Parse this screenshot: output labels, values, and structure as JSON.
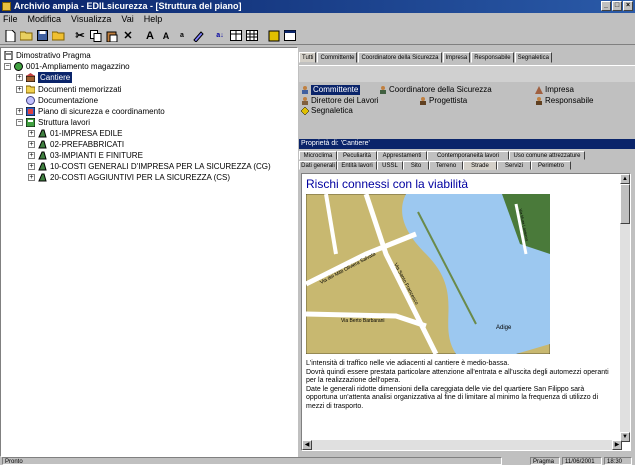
{
  "window": {
    "title": "Archivio ampia - EDILsicurezza - [Struttura del piano]"
  },
  "menu": [
    "File",
    "Modifica",
    "Visualizza",
    "Vai",
    "Help"
  ],
  "toolbar": {
    "icons": [
      "new-icon",
      "open-icon",
      "save-icon",
      "folder-icon",
      "cut-icon",
      "copy-icon",
      "paste-icon",
      "delete-icon",
      "font-bold-icon",
      "font-size-up-icon",
      "font-size-down-icon",
      "format-icon",
      "sort-icon",
      "table-icon",
      "grid-icon",
      "properties-icon",
      "window-icon"
    ]
  },
  "tree": [
    {
      "label": "Dimostrativo Pragma",
      "level": 0,
      "icon": "project-icon",
      "expander": ""
    },
    {
      "label": "001-Ampliamento magazzino",
      "level": 0,
      "icon": "building-icon",
      "expander": "-"
    },
    {
      "label": "Cantiere",
      "level": 1,
      "icon": "site-icon",
      "expander": "+",
      "selected": true
    },
    {
      "label": "Documenti memorizzati",
      "level": 1,
      "icon": "folder-icon",
      "expander": "+"
    },
    {
      "label": "Documentazione",
      "level": 1,
      "icon": "document-icon",
      "expander": ""
    },
    {
      "label": "Piano di sicurezza e coordinamento",
      "level": 1,
      "icon": "plan-icon",
      "expander": "+"
    },
    {
      "label": "Struttura lavori",
      "level": 1,
      "icon": "structure-icon",
      "expander": "-"
    },
    {
      "label": "01-IMPRESA EDILE",
      "level": 2,
      "icon": "work-icon",
      "expander": "+"
    },
    {
      "label": "02-PREFABBRICATI",
      "level": 2,
      "icon": "work-icon",
      "expander": "+"
    },
    {
      "label": "03-IMPIANTI E FINITURE",
      "level": 2,
      "icon": "work-icon",
      "expander": "+"
    },
    {
      "label": "10-COSTI GENERALI D'IMPRESA PER LA SICUREZZA (CG)",
      "level": 2,
      "icon": "work-icon",
      "expander": "+"
    },
    {
      "label": "20-COSTI AGGIUNTIVI PER LA SICUREZZA (CS)",
      "level": 2,
      "icon": "work-icon",
      "expander": "+"
    }
  ],
  "top_tabs": [
    "Tutti",
    "Committente",
    "Coordinatore della Sicurezza",
    "Impresa",
    "Responsabile",
    "Segnaletica"
  ],
  "resources": [
    {
      "label": "Committente",
      "icon": "person-icon",
      "selected": true
    },
    {
      "label": "Coordinatore della Sicurezza",
      "icon": "person-icon"
    },
    {
      "label": "Impresa",
      "icon": "company-icon"
    },
    {
      "label": "Direttore dei Lavori",
      "icon": "person-icon"
    },
    {
      "label": "Progettista",
      "icon": "person-icon"
    },
    {
      "label": "Responsabile",
      "icon": "person-icon"
    },
    {
      "label": "Segnaletica",
      "icon": "sign-icon"
    }
  ],
  "properties": {
    "title": "Proprietà di: 'Cantiere'",
    "tab_row1": [
      "Microclima",
      "Peculiarità",
      "Apprestamenti",
      "Contemporaneità lavori",
      "Uso comune attrezzature"
    ],
    "tab_row2": [
      "Dati generali",
      "Entità lavori",
      "USSL",
      "Sito",
      "Terreno",
      "Strade",
      "Servizi",
      "Perimetro"
    ],
    "active_tab": "Strade",
    "heading": "Rischi connessi con la viabilità",
    "map_labels": {
      "road1": "Via dei Mitti Oliviera Salvata",
      "road2": "Via Santo Francesco",
      "road3": "Via Berto Barbarani",
      "river": "Adige",
      "street_right": "Via Mura Lanterno"
    },
    "description": "L'intensità di traffico nelle vie adiacenti al cantiere è medio-bassa.\nDovrà quindi essere prestata particolare attenzione all'entrata e all'uscita degli automezzi operanti per la realizzazione dell'opera.\nDate le generali ridotte dimensioni della careggiata delle vie del quartiere San Filippo sarà opportuna un'attenta analisi organizzativa al fine di limitare al minimo la frequenza di utilizzo di mezzi di trasporto."
  },
  "status": {
    "left": "Pronto",
    "user": "Pragma",
    "date": "11/06/2001",
    "time": "18:30"
  },
  "colors": {
    "selection": "#0a246a",
    "heading": "#0000a0",
    "title_gradient_start": "#0a246a",
    "river": "#9cc8f0",
    "land": "#c8b870",
    "park": "#4a7a3a"
  }
}
